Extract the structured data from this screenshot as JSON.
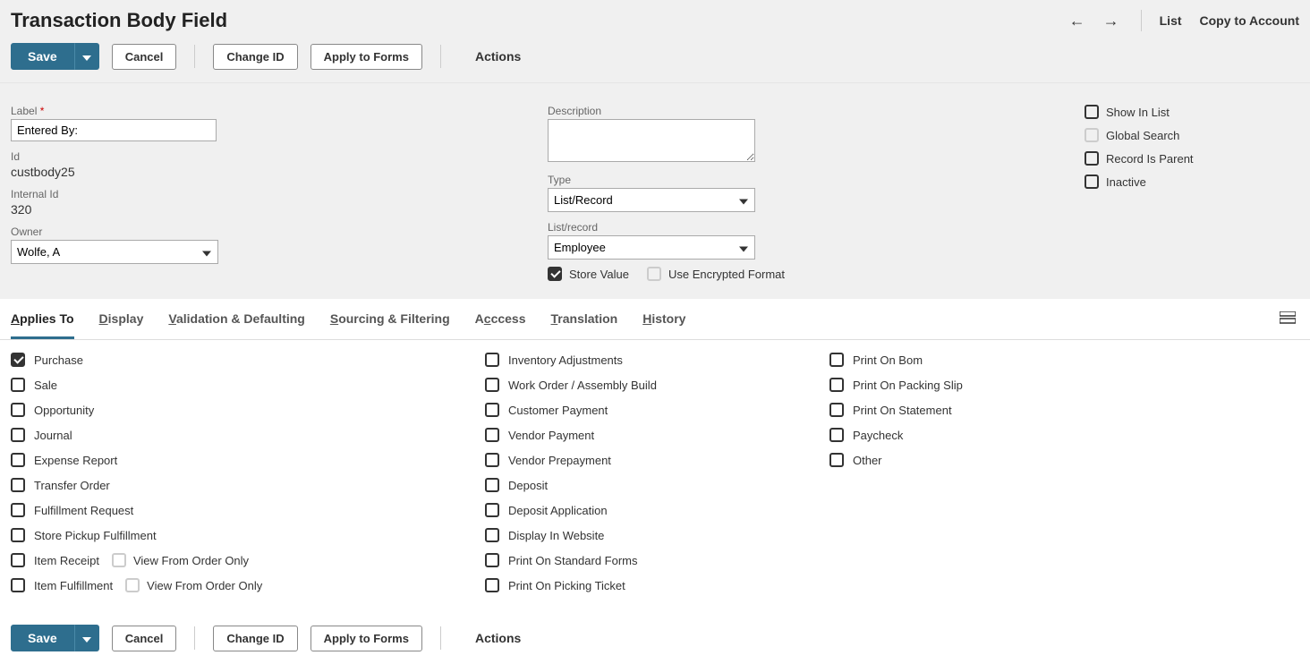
{
  "header": {
    "title": "Transaction Body Field",
    "nav_list": "List",
    "nav_copy": "Copy to Account"
  },
  "buttons": {
    "save": "Save",
    "cancel": "Cancel",
    "change_id": "Change ID",
    "apply_to_forms": "Apply to Forms",
    "actions": "Actions"
  },
  "form": {
    "label_label": "Label",
    "label_value": "Entered By:",
    "id_label": "Id",
    "id_value": "custbody25",
    "internal_id_label": "Internal Id",
    "internal_id_value": "320",
    "owner_label": "Owner",
    "owner_value": "Wolfe, A",
    "description_label": "Description",
    "description_value": "",
    "type_label": "Type",
    "type_value": "List/Record",
    "listrecord_label": "List/record",
    "listrecord_value": "Employee",
    "store_value_label": "Store Value",
    "encrypted_label": "Use Encrypted Format",
    "show_in_list": "Show In List",
    "global_search": "Global Search",
    "record_is_parent": "Record Is Parent",
    "inactive": "Inactive"
  },
  "tabs": {
    "applies_to": "pplies To",
    "display": "isplay",
    "validation": "alidation & Defaulting",
    "sourcing": "ourcing & Filtering",
    "access": "ccess",
    "translation": "ranslation",
    "history": "istory"
  },
  "applies": {
    "col1": [
      {
        "label": "Purchase",
        "checked": true
      },
      {
        "label": "Sale",
        "checked": false
      },
      {
        "label": "Opportunity",
        "checked": false
      },
      {
        "label": "Journal",
        "checked": false
      },
      {
        "label": "Expense Report",
        "checked": false
      },
      {
        "label": "Transfer Order",
        "checked": false
      },
      {
        "label": "Fulfillment Request",
        "checked": false
      },
      {
        "label": "Store Pickup Fulfillment",
        "checked": false
      },
      {
        "label": "Item Receipt",
        "checked": false,
        "sub": "View From Order Only"
      },
      {
        "label": "Item Fulfillment",
        "checked": false,
        "sub": "View From Order Only"
      }
    ],
    "col2": [
      {
        "label": "Inventory Adjustments",
        "checked": false
      },
      {
        "label": "Work Order / Assembly Build",
        "checked": false
      },
      {
        "label": "Customer Payment",
        "checked": false
      },
      {
        "label": "Vendor Payment",
        "checked": false
      },
      {
        "label": "Vendor Prepayment",
        "checked": false
      },
      {
        "label": "Deposit",
        "checked": false
      },
      {
        "label": "Deposit Application",
        "checked": false
      },
      {
        "label": "Display In Website",
        "checked": false
      },
      {
        "label": "Print On Standard Forms",
        "checked": false
      },
      {
        "label": "Print On Picking Ticket",
        "checked": false
      }
    ],
    "col3": [
      {
        "label": "Print On Bom",
        "checked": false
      },
      {
        "label": "Print On Packing Slip",
        "checked": false
      },
      {
        "label": "Print On Statement",
        "checked": false
      },
      {
        "label": "Paycheck",
        "checked": false
      },
      {
        "label": "Other",
        "checked": false
      }
    ]
  }
}
